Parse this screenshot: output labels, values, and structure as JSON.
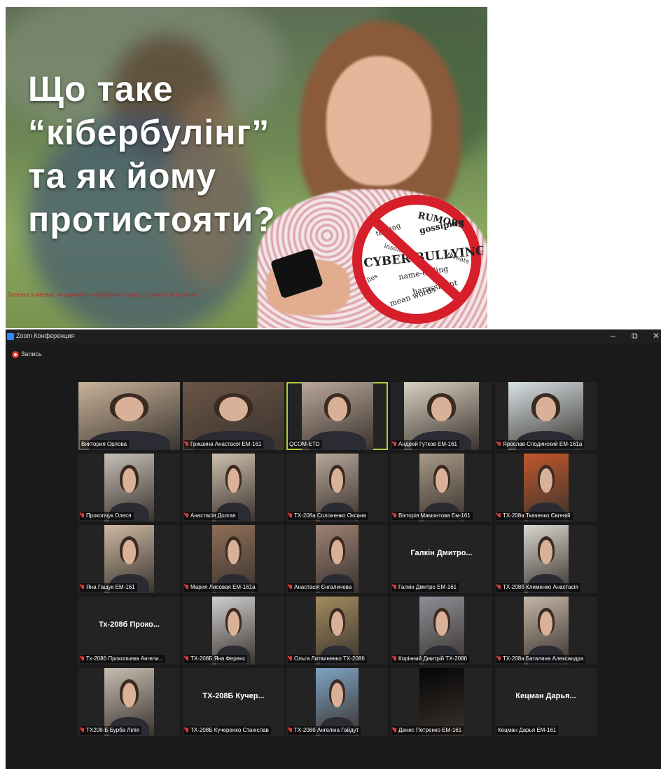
{
  "slide": {
    "title": "Що таке\n“кібербулінг”\nта як йому\nпротистояти?",
    "stop_sign_words": [
      "RUMORS",
      "teasing",
      "gossiping",
      "insults",
      "threats",
      "CYBER BULLYING",
      "lies",
      "name-calling",
      "harassment",
      "mean words"
    ],
    "caption": "Безпека в мережі: як протидіяти кібербулінгу серед студентів та підлітків"
  },
  "zoom": {
    "window_title": "Zoom Конференция",
    "controls": {
      "minimize": "–",
      "maximize": "⧉",
      "close": "✕"
    },
    "recording_label": "Запись",
    "active_border_color": "#b4cc3a",
    "participants": [
      {
        "name": "Виктория Орлова",
        "muted": false,
        "video": "#c9b39a"
      },
      {
        "name": "Гришина Анастасія ЕМ-161",
        "muted": true,
        "video": "#6a5546"
      },
      {
        "name": "QCOM-ЕТD",
        "muted": false,
        "video": "#b9a79a",
        "active": true
      },
      {
        "name": "Андрей Гутков ЕМ-161",
        "muted": true,
        "video": "#d7cfc0"
      },
      {
        "name": "Ярослав Сподинский ЕМ-161а",
        "muted": true,
        "video": "#d8e2e6"
      },
      {
        "name": "Прокопчук Олеся",
        "muted": true,
        "video": "#c5c0b6"
      },
      {
        "name": "Анастасія Долгая",
        "muted": true,
        "video": "#cdbfae"
      },
      {
        "name": "ТХ-208а Солоненко Оксана",
        "muted": true,
        "video": "#b8a69a"
      },
      {
        "name": "Вікторія Мамонтова Ем-161",
        "muted": true,
        "video": "#a89988"
      },
      {
        "name": "ТХ-208а Ткаченко Євгеній",
        "muted": true,
        "video": "#c2572b"
      },
      {
        "name": "Яна Гащук ЕМ-161",
        "muted": true,
        "video": "#cdb9a3"
      },
      {
        "name": "Мария Лисовая ЕМ-161а",
        "muted": true,
        "video": "#8f6f58"
      },
      {
        "name": "Анастасія Єнгаличева",
        "muted": true,
        "video": "#9c8272"
      },
      {
        "name": "Галкін Дмитро ЕМ-161",
        "muted": true,
        "display": "Галкін Дмитро..."
      },
      {
        "name": "ТХ-208б Клименко Анастасія",
        "muted": true,
        "video": "#d9d6cf"
      },
      {
        "name": "Тх-208б Прокопьева Ангели...",
        "muted": true,
        "display": "Тх-208б Проко..."
      },
      {
        "name": "ТХ-208Б Яна Ференс",
        "muted": true,
        "video": "#cfcfcf"
      },
      {
        "name": "Ольга Литвиненко ТХ-208б",
        "muted": true,
        "video": "#a38b5e"
      },
      {
        "name": "Корінний Дмитрій ТХ-208б",
        "muted": true,
        "video": "#8d8f97"
      },
      {
        "name": "ТХ-208а Баталина Александра",
        "muted": true,
        "video": "#c4b5a6"
      },
      {
        "name": "ТХ208-Б Бурба Лілія",
        "muted": true,
        "video": "#c8bdb2"
      },
      {
        "name": "ТХ-208Б Кучеренко Станіслав",
        "muted": true,
        "display": "ТХ-208Б Кучер..."
      },
      {
        "name": "ТХ-208б Ангеліна Гайдут",
        "muted": true,
        "video": "#7da3c4"
      },
      {
        "name": "Денис Петренко ЕМ-161",
        "muted": true,
        "video": "#050505"
      },
      {
        "name": "Кецман Дарья ЕМ-161",
        "muted": false,
        "display": "Кецман Дарья..."
      }
    ]
  }
}
